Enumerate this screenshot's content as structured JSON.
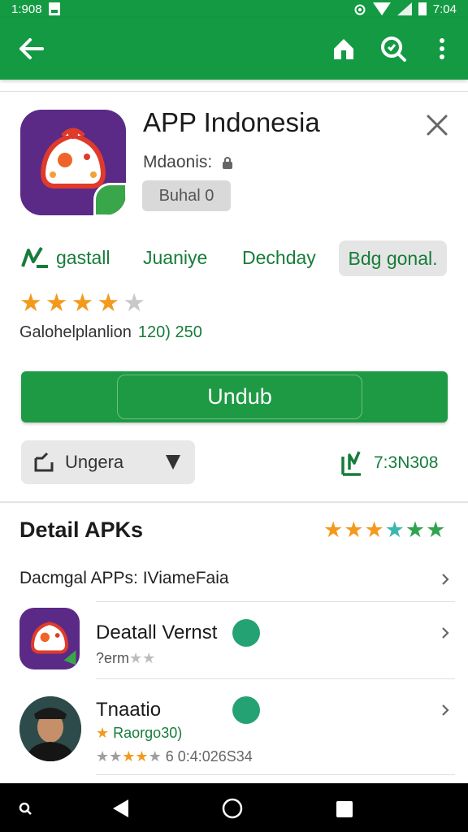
{
  "status_bar": {
    "time_left": "1:908",
    "time_right": "7:04"
  },
  "app_bar": {
    "back_icon": "arrow-left-icon",
    "actions": [
      "home-icon",
      "search-icon",
      "more-vert-icon"
    ]
  },
  "app": {
    "title": "APP Indonesia",
    "developer": "Mdaonis:",
    "chip": "Buhal 0"
  },
  "tabs": [
    {
      "label": "gastall"
    },
    {
      "label": "Juaniye"
    },
    {
      "label": "Dechday"
    },
    {
      "label": "Bdg gonal."
    }
  ],
  "rating": {
    "stars": 4,
    "out_of": 5,
    "meta_label": "Galohelplanlion",
    "meta_value": "120) 250"
  },
  "primary_button": {
    "label": "Undub"
  },
  "dropdown": {
    "label": "Ungera"
  },
  "download_count": "7:3N308",
  "detail": {
    "title": "Detail APKs",
    "link_row": "Dacmgal APPs: IViameFaia",
    "items": [
      {
        "title": "Deatall Vernst",
        "sub": "?erm"
      },
      {
        "title": "Tnaatio",
        "sub": "Raorgo30)",
        "sub2": "6 0:4:026S34"
      }
    ]
  },
  "colors": {
    "primary": "#149a43",
    "accent_green": "#167c3a",
    "star_orange": "#f39a1e",
    "star_teal": "#3ab6b0",
    "icon_purple": "#5b2a86"
  }
}
